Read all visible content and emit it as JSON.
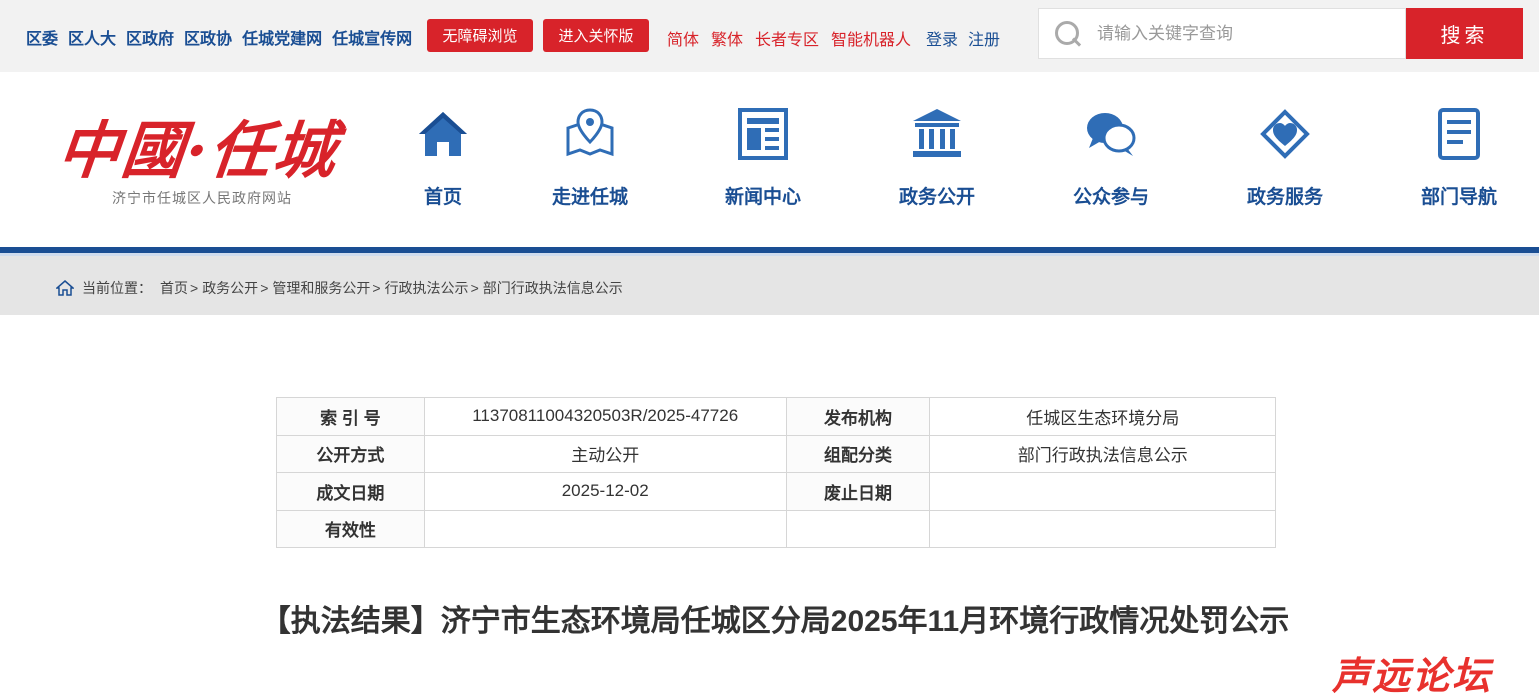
{
  "topbar": {
    "links": [
      "区委",
      "区人大",
      "区政府",
      "区政协",
      "任城党建网",
      "任城宣传网"
    ],
    "accessible_button": "无障碍浏览",
    "care_button": "进入关怀版",
    "options": [
      "简体",
      "繁体",
      "长者专区",
      "智能机器人"
    ],
    "login": "登录",
    "register": "注册",
    "search_placeholder": "请输入关键字查询",
    "search_button": "搜索"
  },
  "header": {
    "logo_title": "中國·任城",
    "logo_subtitle": "济宁市任城区人民政府网站",
    "nav": [
      {
        "label": "首页",
        "icon": "home-icon"
      },
      {
        "label": "走进任城",
        "icon": "map-pin-icon"
      },
      {
        "label": "新闻中心",
        "icon": "newspaper-icon"
      },
      {
        "label": "政务公开",
        "icon": "government-building-icon"
      },
      {
        "label": "公众参与",
        "icon": "chat-bubbles-icon"
      },
      {
        "label": "政务服务",
        "icon": "heart-diamond-icon"
      },
      {
        "label": "部门导航",
        "icon": "document-list-icon"
      }
    ]
  },
  "breadcrumb": {
    "prefix": "当前位置：",
    "items": [
      "首页",
      "政务公开",
      "管理和服务公开",
      "行政执法公示",
      "部门行政执法信息公示"
    ]
  },
  "info": {
    "rows": [
      {
        "k1": "索 引 号",
        "v1": "11370811004320503R/2025-47726",
        "k2": "发布机构",
        "v2": "任城区生态环境分局"
      },
      {
        "k1": "公开方式",
        "v1": "主动公开",
        "k2": "组配分类",
        "v2": "部门行政执法信息公示"
      },
      {
        "k1": "成文日期",
        "v1": "2025-12-02",
        "k2": "废止日期",
        "v2": ""
      },
      {
        "k1": "有效性",
        "v1": "",
        "k2": "",
        "v2": ""
      }
    ]
  },
  "article": {
    "title": "【执法结果】济宁市生态环境局任城区分局2025年11月环境行政情况处罚公示"
  },
  "watermark": "声远论坛",
  "colors": {
    "brand_blue": "#1a4e93",
    "brand_red": "#d8232a"
  }
}
